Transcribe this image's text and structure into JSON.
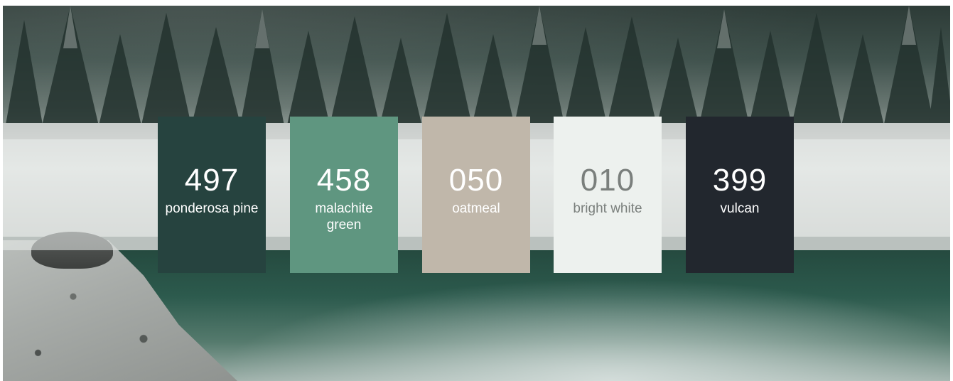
{
  "swatches": [
    {
      "code": "497",
      "name": "ponderosa pine",
      "color": "#26433f",
      "text_color": "#ffffff"
    },
    {
      "code": "458",
      "name": "malachite green",
      "color": "#5f9680",
      "text_color": "#ffffff"
    },
    {
      "code": "050",
      "name": "oatmeal",
      "color": "#c0b7aa",
      "text_color": "#ffffff"
    },
    {
      "code": "010",
      "name": "bright white",
      "color": "#edf1ee",
      "text_color": "#7a7f7c"
    },
    {
      "code": "399",
      "name": "vulcan",
      "color": "#22272e",
      "text_color": "#ffffff"
    }
  ]
}
